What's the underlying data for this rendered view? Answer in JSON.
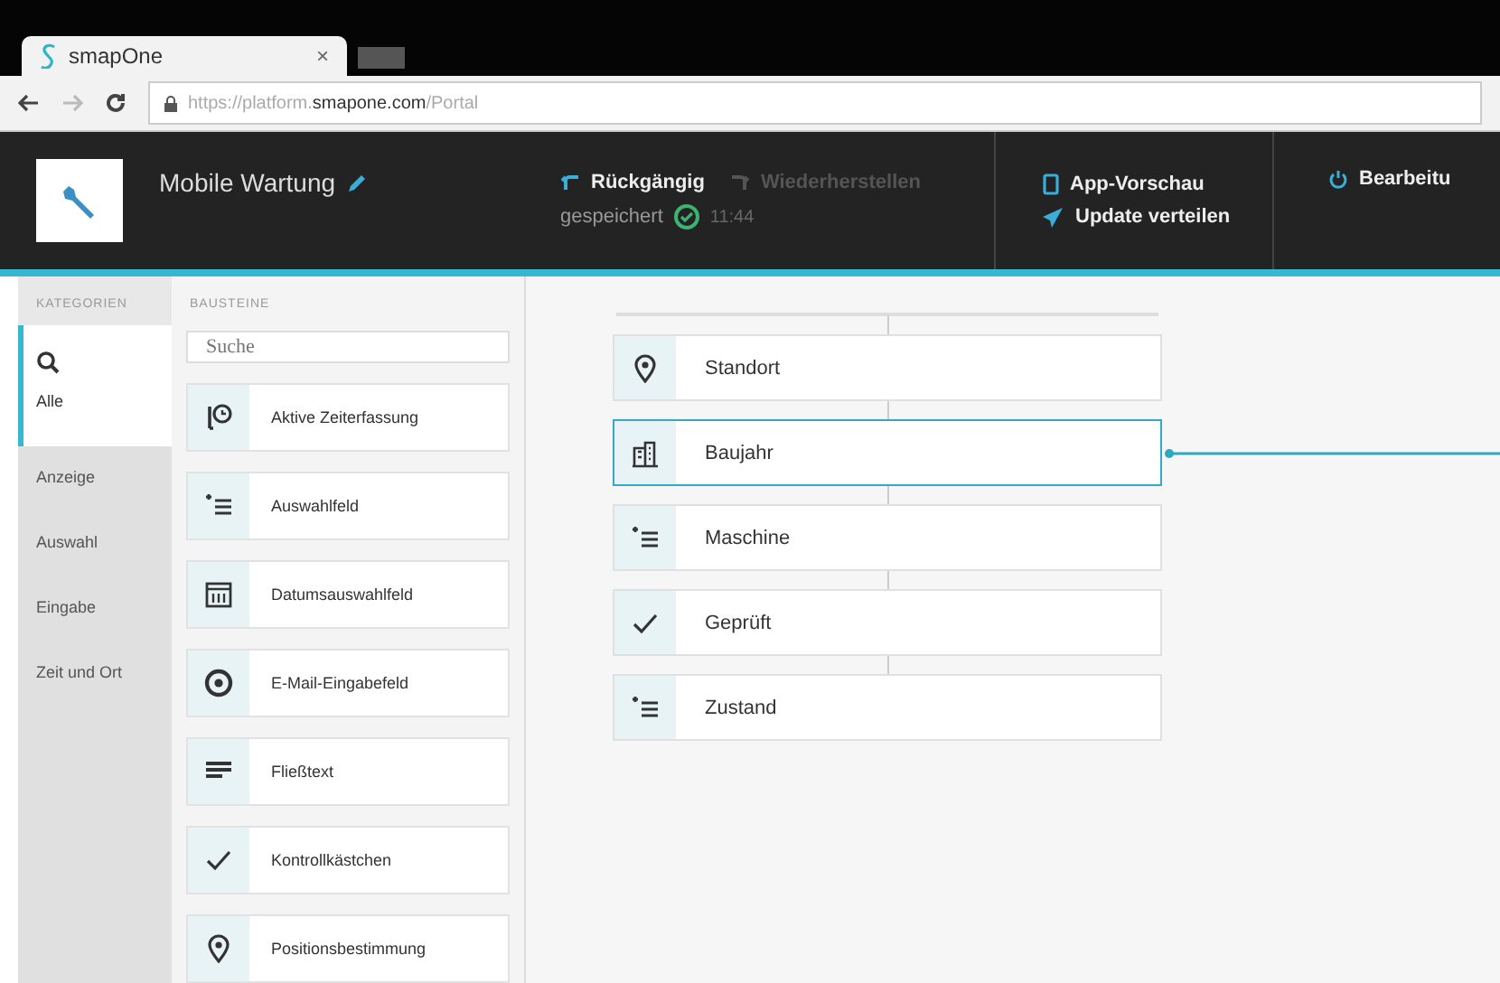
{
  "browser": {
    "tab_title": "smapOne",
    "tab_close": "×",
    "url_prefix": "https://platform.",
    "url_domain": "smapone.com",
    "url_path": "/Portal"
  },
  "header": {
    "app_name": "Mobile Wartung",
    "actions": [
      {
        "kind": "undo",
        "label": "Rückgängig",
        "disabled": false
      },
      {
        "kind": "redo",
        "label": "Wiederherstellen",
        "disabled": true
      }
    ],
    "save_status": "gespeichert",
    "save_time": "11:44",
    "preview": "App-Vorschau",
    "publish": "Update verteilen",
    "edit": "Bearbeitu"
  },
  "categories": {
    "heading": "KATEGORIEN",
    "items": [
      {
        "label": "Alle",
        "selected": true
      },
      {
        "label": "Anzeige",
        "selected": false
      },
      {
        "label": "Auswahl",
        "selected": false
      },
      {
        "label": "Eingabe",
        "selected": false
      },
      {
        "label": "Zeit und Ort",
        "selected": false
      }
    ]
  },
  "blocks": {
    "heading": "BAUSTEINE",
    "search_placeholder": "Suche",
    "items": [
      {
        "kind": "timer",
        "label": "Aktive Zeiterfassung"
      },
      {
        "kind": "list",
        "label": "Auswahlfeld"
      },
      {
        "kind": "calendar",
        "label": "Datumsauswahlfeld"
      },
      {
        "kind": "at",
        "label": "E-Mail-Eingabefeld"
      },
      {
        "kind": "text",
        "label": "Fließtext"
      },
      {
        "kind": "check",
        "label": "Kontrollkästchen"
      },
      {
        "kind": "pin",
        "label": "Positionsbestimmung"
      }
    ]
  },
  "canvas": {
    "fields": [
      {
        "kind": "pin",
        "label": "Standort",
        "selected": false
      },
      {
        "kind": "building",
        "label": "Baujahr",
        "selected": true
      },
      {
        "kind": "list",
        "label": "Maschine",
        "selected": false
      },
      {
        "kind": "check",
        "label": "Geprüft",
        "selected": false
      },
      {
        "kind": "list",
        "label": "Zustand",
        "selected": false
      }
    ]
  }
}
